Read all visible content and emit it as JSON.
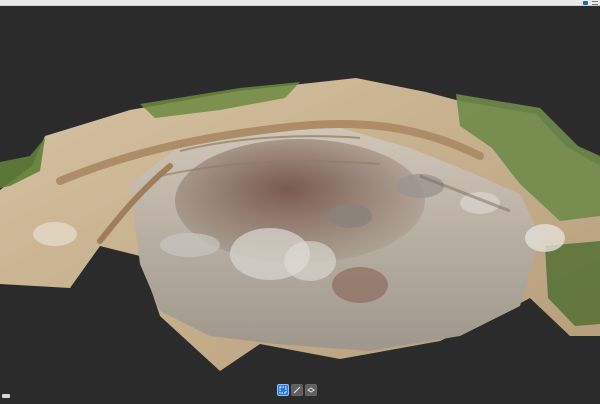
{
  "window": {
    "title": ""
  },
  "header": {
    "user_label": ""
  },
  "viewport": {
    "subject": "3d-point-cloud-quarry"
  },
  "toolbar": {
    "items": [
      {
        "icon": "selection-box-icon",
        "active": true
      },
      {
        "icon": "measure-line-icon",
        "active": false
      },
      {
        "icon": "layers-icon",
        "active": false
      }
    ]
  },
  "colors": {
    "background": "#2b2b2b",
    "titlebar": "#e9e9e9",
    "accent": "#2f78d8"
  }
}
